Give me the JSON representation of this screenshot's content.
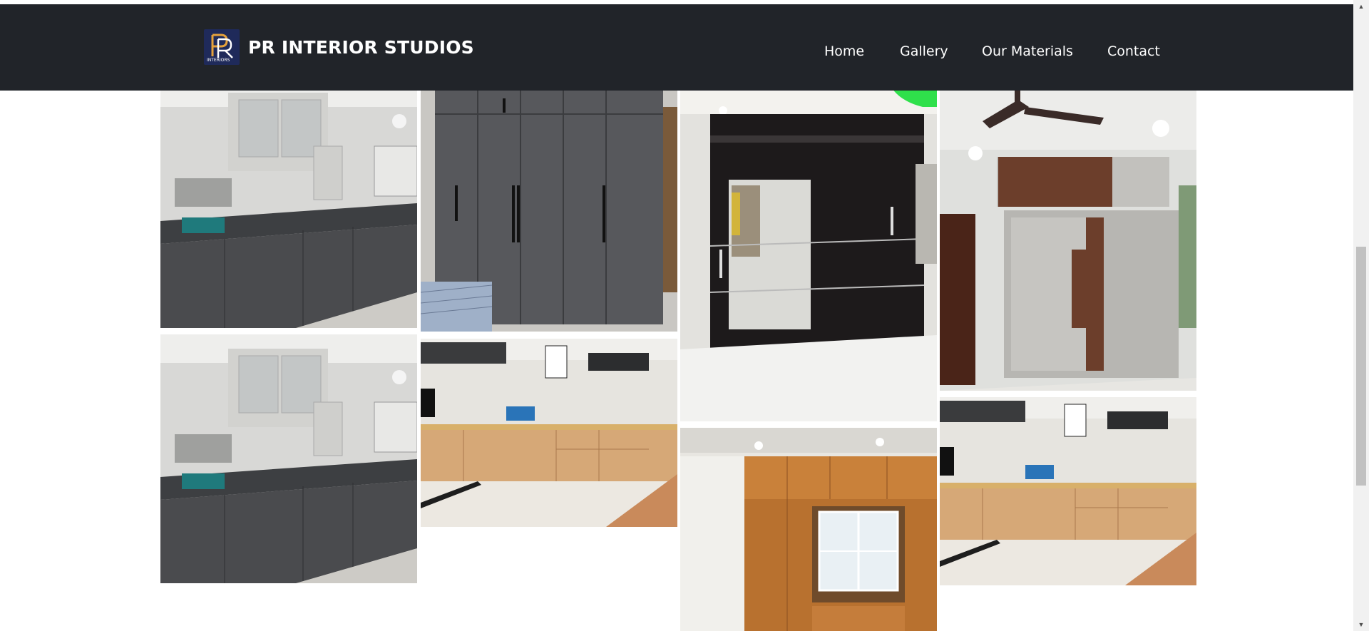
{
  "brand": {
    "name": "PR INTERIOR STUDIOS",
    "logo_text": "INTERIORS",
    "logo_letters": "PR"
  },
  "nav": {
    "items": [
      "Home",
      "Gallery",
      "Our Materials",
      "Contact"
    ]
  },
  "gallery": {
    "photos": [
      {
        "name": "gallery-photo-kitchen-grey-1",
        "alt": "Grey modular kitchen"
      },
      {
        "name": "gallery-photo-kitchen-grey-2",
        "alt": "Grey modular kitchen"
      },
      {
        "name": "gallery-photo-wardrobe-grey",
        "alt": "Grey wardrobe"
      },
      {
        "name": "gallery-photo-kitchen-wood-1",
        "alt": "Wooden modular kitchen"
      },
      {
        "name": "gallery-photo-wardrobe-sliding-mirror",
        "alt": "Sliding mirror wardrobe"
      },
      {
        "name": "gallery-photo-wardrobe-wood-window",
        "alt": "Wooden wardrobe with window"
      },
      {
        "name": "gallery-photo-wardrobe-sliding-fan",
        "alt": "Sliding wardrobe with ceiling fan"
      },
      {
        "name": "gallery-photo-kitchen-wood-2",
        "alt": "Wooden modular kitchen"
      }
    ]
  },
  "colors": {
    "navbar": "#212429",
    "logo_bg": "#1f2a5a",
    "logo_accent": "#e6a23c"
  }
}
